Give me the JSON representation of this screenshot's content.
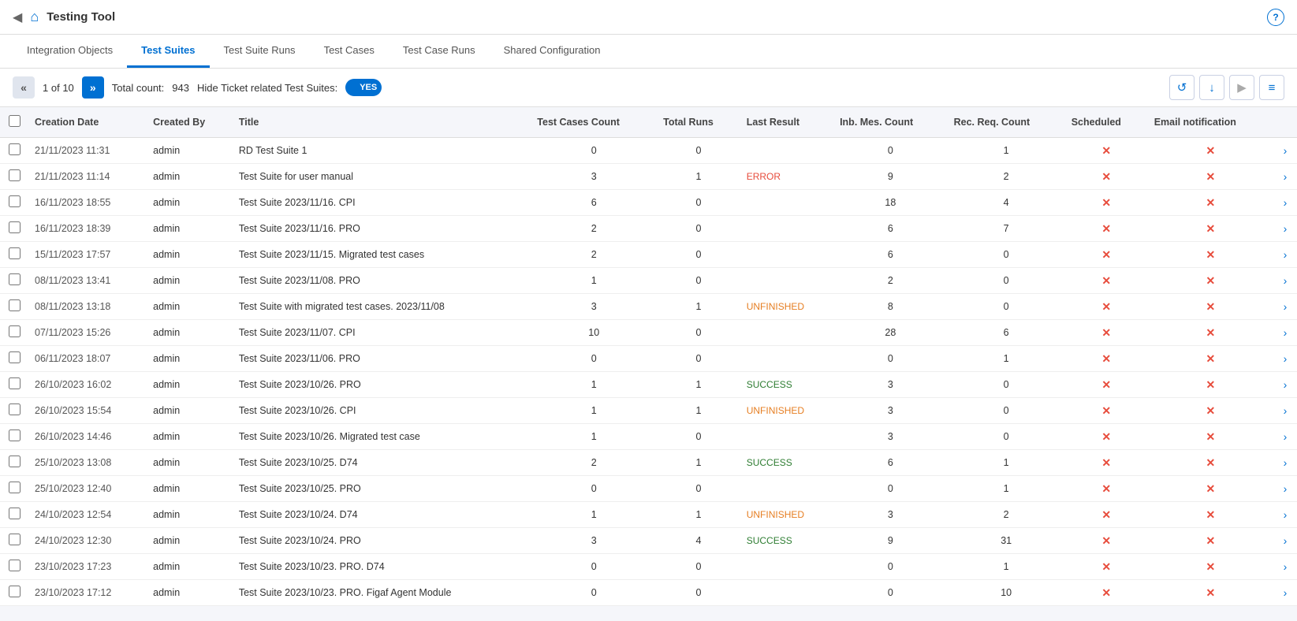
{
  "app": {
    "title": "Testing Tool",
    "back_icon": "◀",
    "home_icon": "⌂",
    "help_icon": "?"
  },
  "nav": {
    "tabs": [
      {
        "id": "integration-objects",
        "label": "Integration Objects",
        "active": false
      },
      {
        "id": "test-suites",
        "label": "Test Suites",
        "active": true
      },
      {
        "id": "test-suite-runs",
        "label": "Test Suite Runs",
        "active": false
      },
      {
        "id": "test-cases",
        "label": "Test Cases",
        "active": false
      },
      {
        "id": "test-case-runs",
        "label": "Test Case Runs",
        "active": false
      },
      {
        "id": "shared-configuration",
        "label": "Shared Configuration",
        "active": false
      }
    ]
  },
  "toolbar": {
    "prev_label": "«",
    "next_label": "»",
    "page_current": "1",
    "page_total": "10",
    "total_count_label": "Total count:",
    "total_count_value": "943",
    "hide_ticket_label": "Hide Ticket related Test Suites:",
    "toggle_value": "YES",
    "refresh_icon": "↺",
    "download_icon": "↓",
    "play_icon": "▶",
    "menu_icon": "≡"
  },
  "table": {
    "columns": [
      "Creation Date",
      "Created By",
      "Title",
      "Test Cases Count",
      "Total Runs",
      "Last Result",
      "Inb. Mes. Count",
      "Rec. Req. Count",
      "Scheduled",
      "Email notification"
    ],
    "rows": [
      {
        "date": "21/11/2023 11:31",
        "created_by": "admin",
        "title": "RD Test Suite 1",
        "tc_count": "0",
        "total_runs": "0",
        "last_result": "",
        "inb_mes": "0",
        "rec_req": "1",
        "scheduled": "x",
        "email": "x"
      },
      {
        "date": "21/11/2023 11:14",
        "created_by": "admin",
        "title": "Test Suite for user manual",
        "tc_count": "3",
        "total_runs": "1",
        "last_result": "ERROR",
        "inb_mes": "9",
        "rec_req": "2",
        "scheduled": "x",
        "email": "x"
      },
      {
        "date": "16/11/2023 18:55",
        "created_by": "admin",
        "title": "Test Suite 2023/11/16. CPI",
        "tc_count": "6",
        "total_runs": "0",
        "last_result": "",
        "inb_mes": "18",
        "rec_req": "4",
        "scheduled": "x",
        "email": "x"
      },
      {
        "date": "16/11/2023 18:39",
        "created_by": "admin",
        "title": "Test Suite 2023/11/16. PRO",
        "tc_count": "2",
        "total_runs": "0",
        "last_result": "",
        "inb_mes": "6",
        "rec_req": "7",
        "scheduled": "x",
        "email": "x"
      },
      {
        "date": "15/11/2023 17:57",
        "created_by": "admin",
        "title": "Test Suite 2023/11/15. Migrated test cases",
        "tc_count": "2",
        "total_runs": "0",
        "last_result": "",
        "inb_mes": "6",
        "rec_req": "0",
        "scheduled": "x",
        "email": "x"
      },
      {
        "date": "08/11/2023 13:41",
        "created_by": "admin",
        "title": "Test Suite 2023/11/08. PRO",
        "tc_count": "1",
        "total_runs": "0",
        "last_result": "",
        "inb_mes": "2",
        "rec_req": "0",
        "scheduled": "x",
        "email": "x"
      },
      {
        "date": "08/11/2023 13:18",
        "created_by": "admin",
        "title": "Test Suite with migrated test cases. 2023/11/08",
        "tc_count": "3",
        "total_runs": "1",
        "last_result": "UNFINISHED",
        "inb_mes": "8",
        "rec_req": "0",
        "scheduled": "x",
        "email": "x"
      },
      {
        "date": "07/11/2023 15:26",
        "created_by": "admin",
        "title": "Test Suite 2023/11/07. CPI",
        "tc_count": "10",
        "total_runs": "0",
        "last_result": "",
        "inb_mes": "28",
        "rec_req": "6",
        "scheduled": "x",
        "email": "x"
      },
      {
        "date": "06/11/2023 18:07",
        "created_by": "admin",
        "title": "Test Suite 2023/11/06. PRO",
        "tc_count": "0",
        "total_runs": "0",
        "last_result": "",
        "inb_mes": "0",
        "rec_req": "1",
        "scheduled": "x",
        "email": "x"
      },
      {
        "date": "26/10/2023 16:02",
        "created_by": "admin",
        "title": "Test Suite 2023/10/26. PRO",
        "tc_count": "1",
        "total_runs": "1",
        "last_result": "SUCCESS",
        "inb_mes": "3",
        "rec_req": "0",
        "scheduled": "x",
        "email": "x"
      },
      {
        "date": "26/10/2023 15:54",
        "created_by": "admin",
        "title": "Test Suite 2023/10/26. CPI",
        "tc_count": "1",
        "total_runs": "1",
        "last_result": "UNFINISHED",
        "inb_mes": "3",
        "rec_req": "0",
        "scheduled": "x",
        "email": "x"
      },
      {
        "date": "26/10/2023 14:46",
        "created_by": "admin",
        "title": "Test Suite 2023/10/26. Migrated test case",
        "tc_count": "1",
        "total_runs": "0",
        "last_result": "",
        "inb_mes": "3",
        "rec_req": "0",
        "scheduled": "x",
        "email": "x"
      },
      {
        "date": "25/10/2023 13:08",
        "created_by": "admin",
        "title": "Test Suite 2023/10/25. D74",
        "tc_count": "2",
        "total_runs": "1",
        "last_result": "SUCCESS",
        "inb_mes": "6",
        "rec_req": "1",
        "scheduled": "x",
        "email": "x"
      },
      {
        "date": "25/10/2023 12:40",
        "created_by": "admin",
        "title": "Test Suite 2023/10/25. PRO",
        "tc_count": "0",
        "total_runs": "0",
        "last_result": "",
        "inb_mes": "0",
        "rec_req": "1",
        "scheduled": "x",
        "email": "x"
      },
      {
        "date": "24/10/2023 12:54",
        "created_by": "admin",
        "title": "Test Suite 2023/10/24. D74",
        "tc_count": "1",
        "total_runs": "1",
        "last_result": "UNFINISHED",
        "inb_mes": "3",
        "rec_req": "2",
        "scheduled": "x",
        "email": "x"
      },
      {
        "date": "24/10/2023 12:30",
        "created_by": "admin",
        "title": "Test Suite 2023/10/24. PRO",
        "tc_count": "3",
        "total_runs": "4",
        "last_result": "SUCCESS",
        "inb_mes": "9",
        "rec_req": "31",
        "scheduled": "x",
        "email": "x"
      },
      {
        "date": "23/10/2023 17:23",
        "created_by": "admin",
        "title": "Test Suite 2023/10/23. PRO. D74",
        "tc_count": "0",
        "total_runs": "0",
        "last_result": "",
        "inb_mes": "0",
        "rec_req": "1",
        "scheduled": "x",
        "email": "x"
      },
      {
        "date": "23/10/2023 17:12",
        "created_by": "admin",
        "title": "Test Suite 2023/10/23. PRO. Figaf Agent Module",
        "tc_count": "0",
        "total_runs": "0",
        "last_result": "",
        "inb_mes": "0",
        "rec_req": "10",
        "scheduled": "x",
        "email": "x"
      }
    ]
  }
}
